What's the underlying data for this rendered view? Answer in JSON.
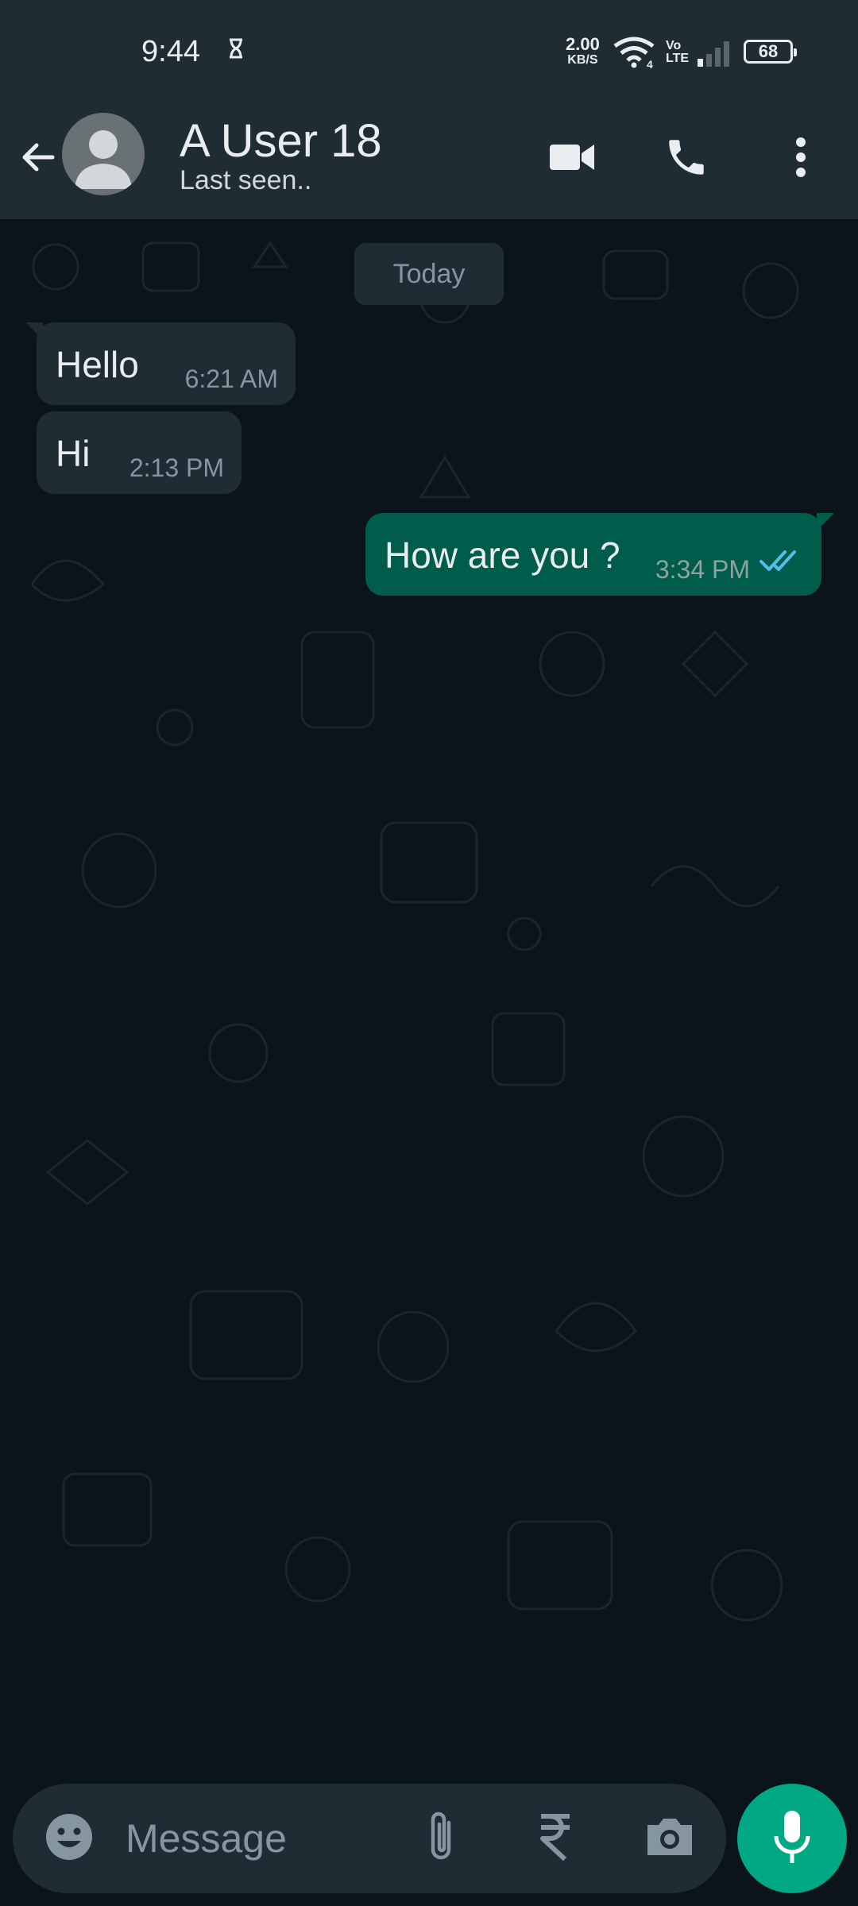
{
  "status_bar": {
    "time": "9:44",
    "net_speed": "2.00",
    "net_speed_unit": "KB/S",
    "network_type": "4",
    "volte_top": "Vo",
    "volte_bottom": "LTE",
    "battery": "68"
  },
  "header": {
    "contact_name": "A User 18",
    "contact_status": "Last seen.."
  },
  "chat": {
    "date_divider": "Today",
    "messages": [
      {
        "direction": "incoming",
        "text": "Hello",
        "time": "6:21 AM"
      },
      {
        "direction": "incoming",
        "text": "Hi",
        "time": "2:13 PM"
      },
      {
        "direction": "outgoing",
        "text": "How are you ?",
        "time": "3:34 PM",
        "status": "read"
      }
    ]
  },
  "composer": {
    "placeholder": "Message"
  },
  "colors": {
    "header_bg": "#1f2c34",
    "chat_bg": "#0b141a",
    "incoming_bubble": "#1f2c34",
    "outgoing_bubble": "#005c4b",
    "accent": "#00a884",
    "read_tick": "#53bdeb"
  },
  "icons": [
    "back-arrow-icon",
    "video-call-icon",
    "voice-call-icon",
    "more-options-icon",
    "emoji-icon",
    "attach-icon",
    "rupee-icon",
    "camera-icon",
    "mic-icon",
    "double-check-icon"
  ]
}
